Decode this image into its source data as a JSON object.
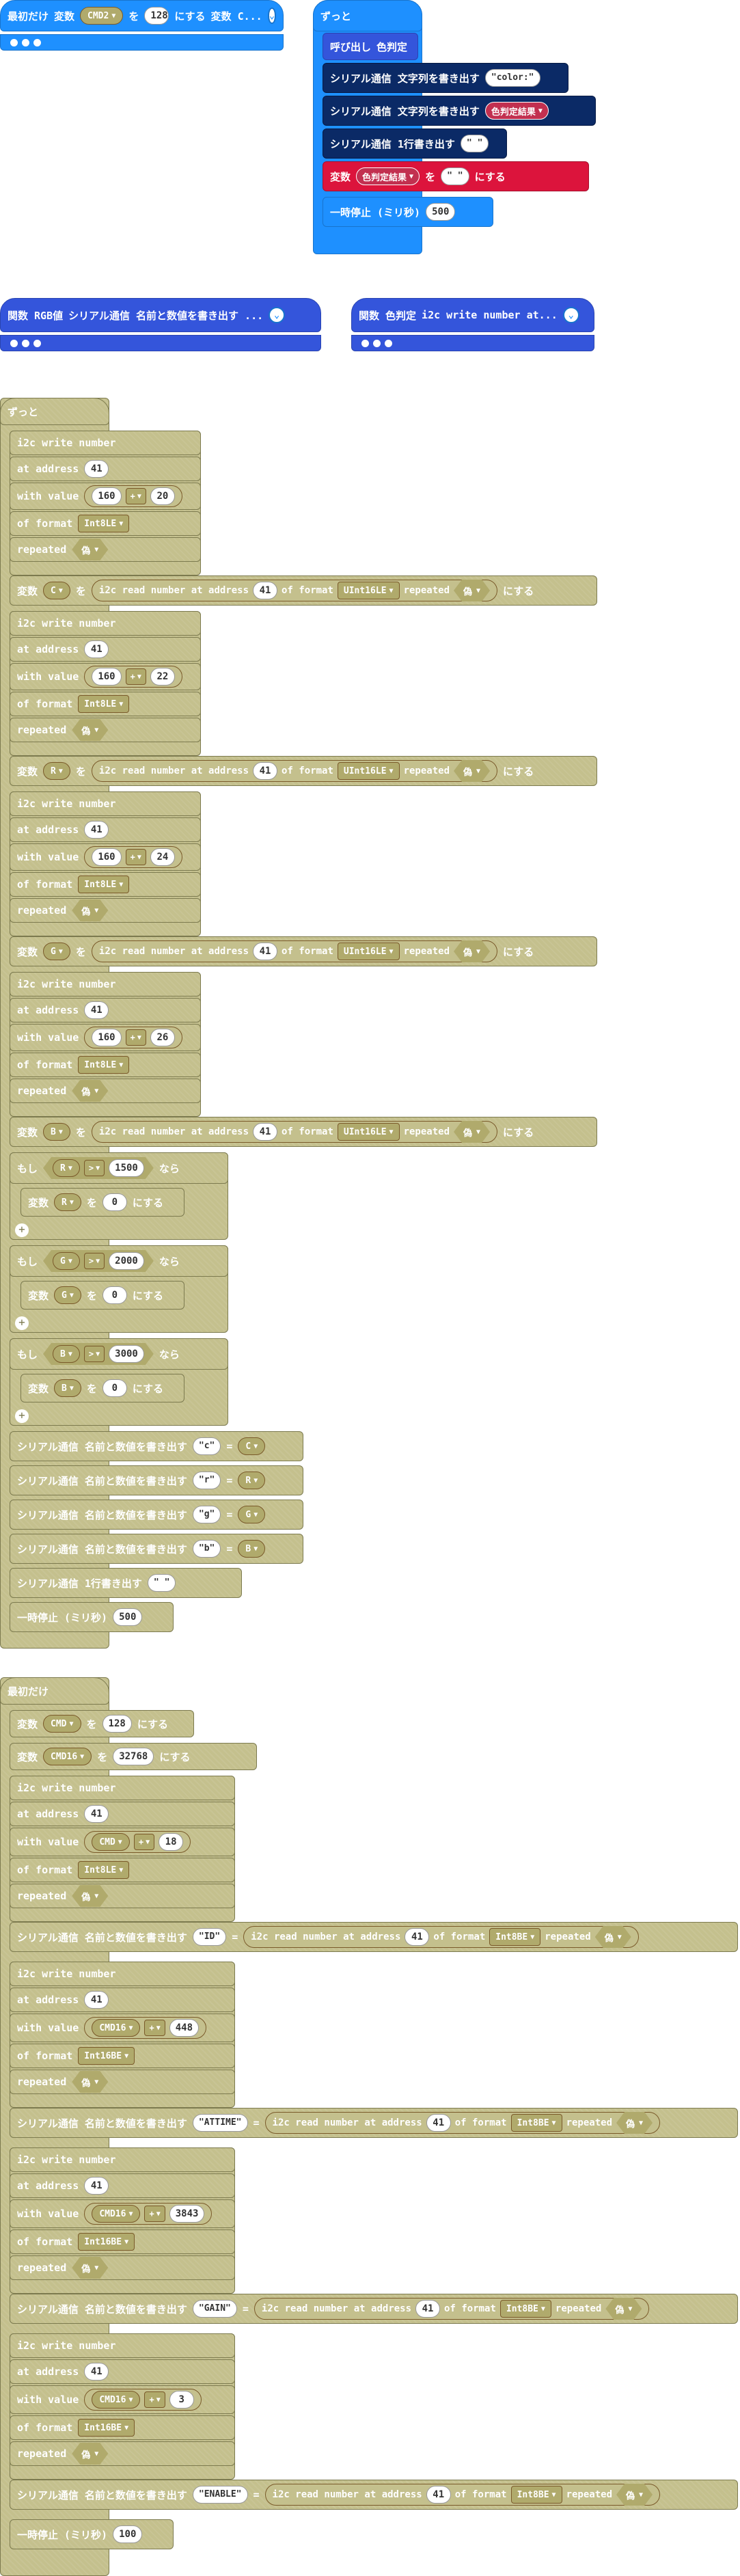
{
  "w1": {
    "label": "最初だけ",
    "set": "変数",
    "var": "CMD2",
    "to": "を",
    "val": "128",
    "action": "にする",
    "rest": "変数 C..."
  },
  "w2": {
    "label": "ずっと",
    "call": "呼び出し",
    "call_fn": "色判定",
    "l1": "シリアル通信 文字列を書き出す",
    "l1_str": "\"color:\"",
    "l2": "シリアル通信 文字列を書き出す",
    "l2_var": "色判定結果",
    "l3": "シリアル通信 1行書き出す",
    "l3_str": "\" \"",
    "set": "変数",
    "set_var": "色判定結果",
    "to": "を",
    "set_str": "\" \"",
    "set_action": "にする",
    "pause": "一時停止 (ミリ秒)",
    "pause_val": "500"
  },
  "w3": {
    "label": "関数 RGB値",
    "rest": "シリアル通信 名前と数値を書き出す ..."
  },
  "w4": {
    "label": "関数 色判定",
    "rest": "i2c write number at..."
  },
  "main1": {
    "label": "ずっと",
    "i2c_write": "i2c write number",
    "at_address": "at address",
    "with_value": "with value",
    "of_format": "of format",
    "repeated": "repeated",
    "addr": "41",
    "base": "160",
    "plus": "+",
    "format": "Int8LE",
    "false": "偽",
    "set": "変数",
    "to": "を",
    "action": "にする",
    "read": "i2c read number at address",
    "of_format_l": "of format",
    "fmt16": "UInt16LE",
    "groups": [
      {
        "val": "20",
        "var": "C"
      },
      {
        "val": "22",
        "var": "R"
      },
      {
        "val": "24",
        "var": "G"
      },
      {
        "val": "26",
        "var": "B"
      }
    ],
    "if": "もし",
    "then": "なら",
    "gt": ">",
    "ifs": [
      {
        "var": "R",
        "lim": "1500"
      },
      {
        "var": "G",
        "lim": "2000"
      },
      {
        "var": "B",
        "lim": "3000"
      }
    ],
    "zero": "0",
    "serial": "シリアル通信 名前と数値を書き出す",
    "eq": "=",
    "pairs": [
      {
        "s": "\"c\"",
        "v": "C"
      },
      {
        "s": "\"r\"",
        "v": "R"
      },
      {
        "s": "\"g\"",
        "v": "G"
      },
      {
        "s": "\"b\"",
        "v": "B"
      }
    ],
    "line": "シリアル通信 1行書き出す",
    "line_str": "\" \"",
    "pause": "一時停止 (ミリ秒)",
    "pause_val": "500"
  },
  "main2": {
    "label": "最初だけ",
    "set": "変数",
    "to": "を",
    "action": "にする",
    "v1": "CMD",
    "v1val": "128",
    "v2": "CMD16",
    "v2val": "32768",
    "i2c_write": "i2c write number",
    "at_address": "at address",
    "with_value": "with value",
    "of_format": "of format",
    "repeated": "repeated",
    "addr": "41",
    "plus": "+",
    "false": "偽",
    "fmt8": "Int8LE",
    "fmt16": "Int16BE",
    "fmtbe": "Int8BE",
    "serial": "シリアル通信 名前と数値を書き出す",
    "eq": "=",
    "read": "i2c read number at address",
    "of_format_l": "of format",
    "groups": [
      {
        "var": "CMD",
        "val": "18",
        "fmt": "Int8LE",
        "name": "\"ID\""
      },
      {
        "var": "CMD16",
        "val": "448",
        "fmt": "Int16BE",
        "name": "\"ATTIME\""
      },
      {
        "var": "CMD16",
        "val": "3843",
        "fmt": "Int16BE",
        "name": "\"GAIN\""
      },
      {
        "var": "CMD16",
        "val": "3",
        "fmt": "Int16BE",
        "name": "\"ENABLE\""
      }
    ],
    "pause": "一時停止 (ミリ秒)",
    "pause_val": "100"
  }
}
